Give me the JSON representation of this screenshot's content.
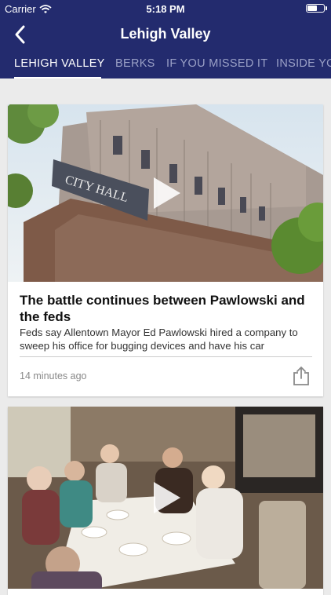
{
  "status_bar": {
    "carrier": "Carrier",
    "time": "5:18 PM"
  },
  "nav": {
    "title": "Lehigh Valley"
  },
  "tabs": [
    {
      "label": "LEHIGH VALLEY",
      "active": true
    },
    {
      "label": "BERKS",
      "active": false
    },
    {
      "label": "IF YOU MISSED IT",
      "active": false
    },
    {
      "label": "INSIDE YO",
      "active": false
    }
  ],
  "articles": [
    {
      "headline": "The battle continues between Pawlowski and the feds",
      "summary": "Feds say Allentown Mayor Ed Pawlowski hired a company to sweep his office for bugging devices and have his car",
      "time_ago": "14 minutes ago",
      "thumb_sign": "CITY HALL"
    },
    {
      "headline": "",
      "summary": "",
      "time_ago": ""
    }
  ],
  "colors": {
    "header_bg": "#232b6e",
    "tab_inactive": "#9aa0c6"
  }
}
